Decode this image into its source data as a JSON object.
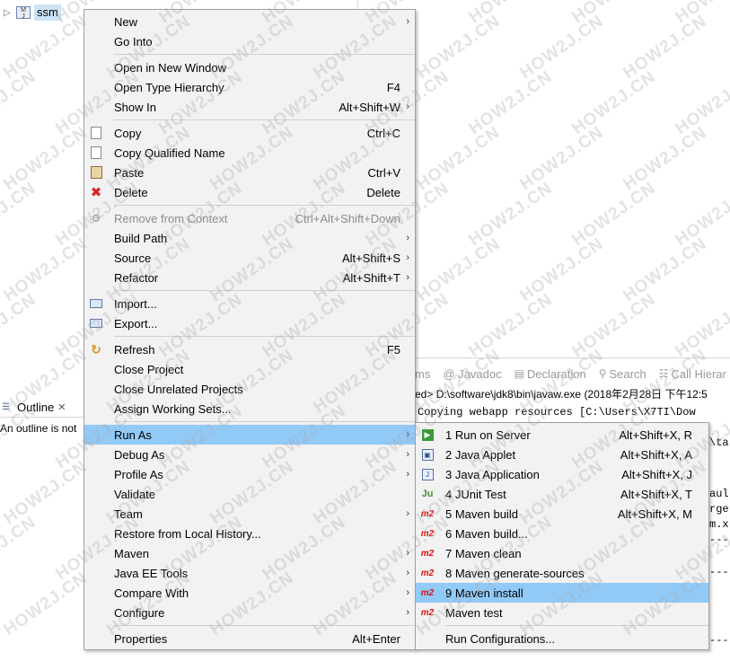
{
  "project_tree": {
    "project_label": "ssm"
  },
  "outline": {
    "tab_label": "Outline",
    "message": "An outline is not"
  },
  "console": {
    "tabs": [
      {
        "label": "ms",
        "icon": "problems-icon"
      },
      {
        "label": "@ Javadoc",
        "icon": "javadoc-icon"
      },
      {
        "label": "Declaration",
        "icon": "declaration-icon"
      },
      {
        "label": "Search",
        "icon": "search-icon"
      },
      {
        "label": "Call Hierar",
        "icon": "call-hierarchy-icon"
      }
    ],
    "header": "ed> D:\\software\\jdk8\\bin\\javaw.exe (2018年2月28日 下午12:5",
    "lines": [
      "Copying webapp resources [C:\\Users\\X7TI\\Dow",
      "\\ta",
      "aul",
      "rge",
      "m.x",
      "---",
      "---",
      "---"
    ]
  },
  "context_menu": {
    "items": [
      {
        "label": "New",
        "has_submenu": true
      },
      {
        "label": "Go Into"
      },
      {
        "sep": true
      },
      {
        "label": "Open in New Window"
      },
      {
        "label": "Open Type Hierarchy",
        "shortcut": "F4"
      },
      {
        "label": "Show In",
        "shortcut": "Alt+Shift+W",
        "has_submenu": true
      },
      {
        "sep": true
      },
      {
        "label": "Copy",
        "shortcut": "Ctrl+C",
        "icon": "copy-icon"
      },
      {
        "label": "Copy Qualified Name",
        "icon": "copy-qualified-name-icon"
      },
      {
        "label": "Paste",
        "shortcut": "Ctrl+V",
        "icon": "paste-icon"
      },
      {
        "label": "Delete",
        "shortcut": "Delete",
        "icon": "delete-icon"
      },
      {
        "sep": true
      },
      {
        "label": "Remove from Context",
        "shortcut": "Ctrl+Alt+Shift+Down",
        "disabled": true,
        "icon": "remove-context-icon"
      },
      {
        "label": "Build Path",
        "has_submenu": true
      },
      {
        "label": "Source",
        "shortcut": "Alt+Shift+S",
        "has_submenu": true
      },
      {
        "label": "Refactor",
        "shortcut": "Alt+Shift+T",
        "has_submenu": true
      },
      {
        "sep": true
      },
      {
        "label": "Import...",
        "icon": "import-icon"
      },
      {
        "label": "Export...",
        "icon": "export-icon"
      },
      {
        "sep": true
      },
      {
        "label": "Refresh",
        "shortcut": "F5",
        "icon": "refresh-icon"
      },
      {
        "label": "Close Project"
      },
      {
        "label": "Close Unrelated Projects"
      },
      {
        "label": "Assign Working Sets..."
      },
      {
        "sep": true
      },
      {
        "label": "Run As",
        "has_submenu": true,
        "selected": true
      },
      {
        "label": "Debug As",
        "has_submenu": true
      },
      {
        "label": "Profile As",
        "has_submenu": true
      },
      {
        "label": "Validate"
      },
      {
        "label": "Team",
        "has_submenu": true
      },
      {
        "label": "Restore from Local History..."
      },
      {
        "label": "Maven",
        "has_submenu": true
      },
      {
        "label": "Java EE Tools",
        "has_submenu": true
      },
      {
        "label": "Compare With",
        "has_submenu": true
      },
      {
        "label": "Configure",
        "has_submenu": true
      },
      {
        "sep": true
      },
      {
        "label": "Properties",
        "shortcut": "Alt+Enter"
      }
    ]
  },
  "run_as_submenu": {
    "items": [
      {
        "label": "1 Run on Server",
        "shortcut": "Alt+Shift+X, R",
        "icon": "run-on-server-icon"
      },
      {
        "label": "2 Java Applet",
        "shortcut": "Alt+Shift+X, A",
        "icon": "java-applet-icon"
      },
      {
        "label": "3 Java Application",
        "shortcut": "Alt+Shift+X, J",
        "icon": "java-application-icon"
      },
      {
        "label": "4 JUnit Test",
        "shortcut": "Alt+Shift+X, T",
        "icon": "junit-icon"
      },
      {
        "label": "5 Maven build",
        "shortcut": "Alt+Shift+X, M",
        "icon": "maven-icon"
      },
      {
        "label": "6 Maven build...",
        "icon": "maven-icon"
      },
      {
        "label": "7 Maven clean",
        "icon": "maven-icon"
      },
      {
        "label": "8 Maven generate-sources",
        "icon": "maven-icon"
      },
      {
        "label": "9 Maven install",
        "icon": "maven-icon",
        "selected": true
      },
      {
        "label": "Maven test",
        "icon": "maven-icon"
      },
      {
        "sep": true
      },
      {
        "label": "Run Configurations..."
      }
    ]
  },
  "watermark": {
    "text": "HOW2J.CN"
  }
}
